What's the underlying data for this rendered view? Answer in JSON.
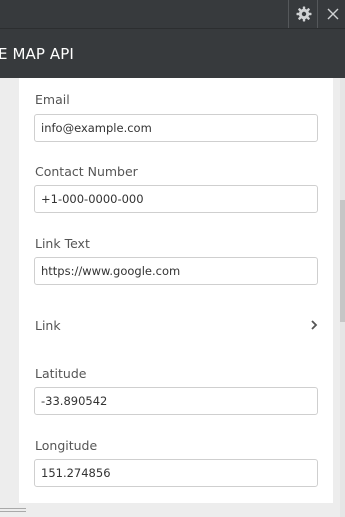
{
  "window": {
    "title": "E MAP API"
  },
  "toolbar": {
    "settings_icon": "gear-icon",
    "close_icon": "close-icon"
  },
  "form": {
    "email": {
      "label": "Email",
      "value": "info@example.com"
    },
    "contact": {
      "label": "Contact Number",
      "value": "+1-000-0000-000"
    },
    "link_text": {
      "label": "Link Text",
      "value": "https://www.google.com"
    },
    "link": {
      "label": "Link",
      "icon": "chevron-right-icon"
    },
    "latitude": {
      "label": "Latitude",
      "value": "-33.890542"
    },
    "longitude": {
      "label": "Longitude",
      "value": "151.274856"
    }
  }
}
